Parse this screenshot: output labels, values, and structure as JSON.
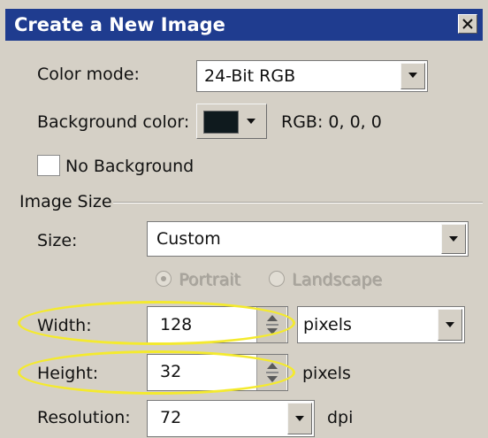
{
  "dialog": {
    "title": "Create a New Image",
    "color_mode": {
      "label": "Color mode:",
      "value": "24-Bit RGB"
    },
    "background_color": {
      "label": "Background color:",
      "swatch_color": "#0f1a1e",
      "rgb_text": "RGB:  0,  0,  0"
    },
    "no_background": {
      "label": "No Background",
      "checked": false
    },
    "image_size": {
      "group_label": "Image Size",
      "size": {
        "label": "Size:",
        "value": "Custom"
      },
      "orientation": {
        "portrait_label": "Portrait",
        "landscape_label": "Landscape",
        "selected": "Portrait",
        "enabled": false
      },
      "width": {
        "label": "Width:",
        "value": "128",
        "unit": "pixels"
      },
      "height": {
        "label": "Height:",
        "value": "32",
        "unit": "pixels"
      },
      "resolution": {
        "label": "Resolution:",
        "value": "72",
        "unit": "dpi"
      }
    },
    "highlight_color": "#f4ea2e",
    "title_bar_color": "#1f3c8f"
  }
}
